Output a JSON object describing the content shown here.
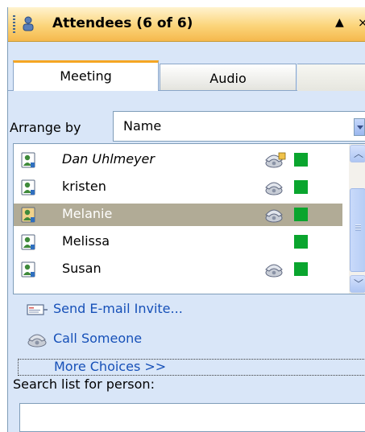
{
  "header": {
    "title": "Attendees (6 of 6)",
    "people_icon": "people-icon",
    "collapse_icon": "triangle-up-icon",
    "close_icon": "close-icon",
    "collapse_glyph": "▲",
    "close_glyph": "×"
  },
  "tabs": [
    {
      "label": "Meeting",
      "active": true
    },
    {
      "label": "Audio",
      "active": false
    }
  ],
  "arrange": {
    "label": "Arrange by",
    "value": "Name"
  },
  "attendees": [
    {
      "name": "Dan Uhlmeyer",
      "italic": true,
      "phone": "phone-presenter-icon",
      "status": "online",
      "selected": false
    },
    {
      "name": "kristen",
      "italic": false,
      "phone": "phone-icon",
      "status": "online",
      "selected": false
    },
    {
      "name": "Melanie",
      "italic": false,
      "phone": "phone-icon",
      "status": "online",
      "selected": true
    },
    {
      "name": "Melissa",
      "italic": false,
      "phone": "",
      "status": "online",
      "selected": false
    },
    {
      "name": "Susan",
      "italic": false,
      "phone": "phone-icon",
      "status": "online",
      "selected": false
    }
  ],
  "colors": {
    "status_online": "#0aa52e",
    "selected_row": "#b1ab96",
    "link": "#1650b8",
    "header_gradient_end": "#f5b94d"
  },
  "actions": {
    "send_invite": "Send E-mail Invite...",
    "call_someone": "Call Someone",
    "more_choices": "More Choices >>"
  },
  "search": {
    "label": "Search list for person:",
    "value": ""
  },
  "scrollbar": {
    "up_glyph": "︿",
    "down_glyph": "﹀"
  }
}
